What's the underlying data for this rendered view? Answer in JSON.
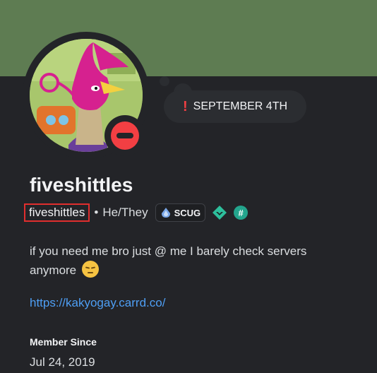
{
  "profile": {
    "display_name": "fiveshittles",
    "username": "fiveshittles",
    "separator": "•",
    "pronouns": "He/They",
    "guild_tag": "SCUG",
    "status": "do-not-disturb",
    "status_color": "#f23f43",
    "banner_color": "#5e7c52",
    "custom_status": {
      "icon": "!",
      "text": "SEPTEMBER 4TH"
    },
    "bio": "if you need me bro just @ me I barely check servers anymore",
    "link": "https://kakyogay.carrd.co/",
    "member_since_label": "Member Since",
    "member_since": "Jul 24, 2019",
    "badges": [
      "guild-tag-icon",
      "quest-badge-icon",
      "hashtag-badge-icon"
    ],
    "hash_badge_label": "#"
  }
}
